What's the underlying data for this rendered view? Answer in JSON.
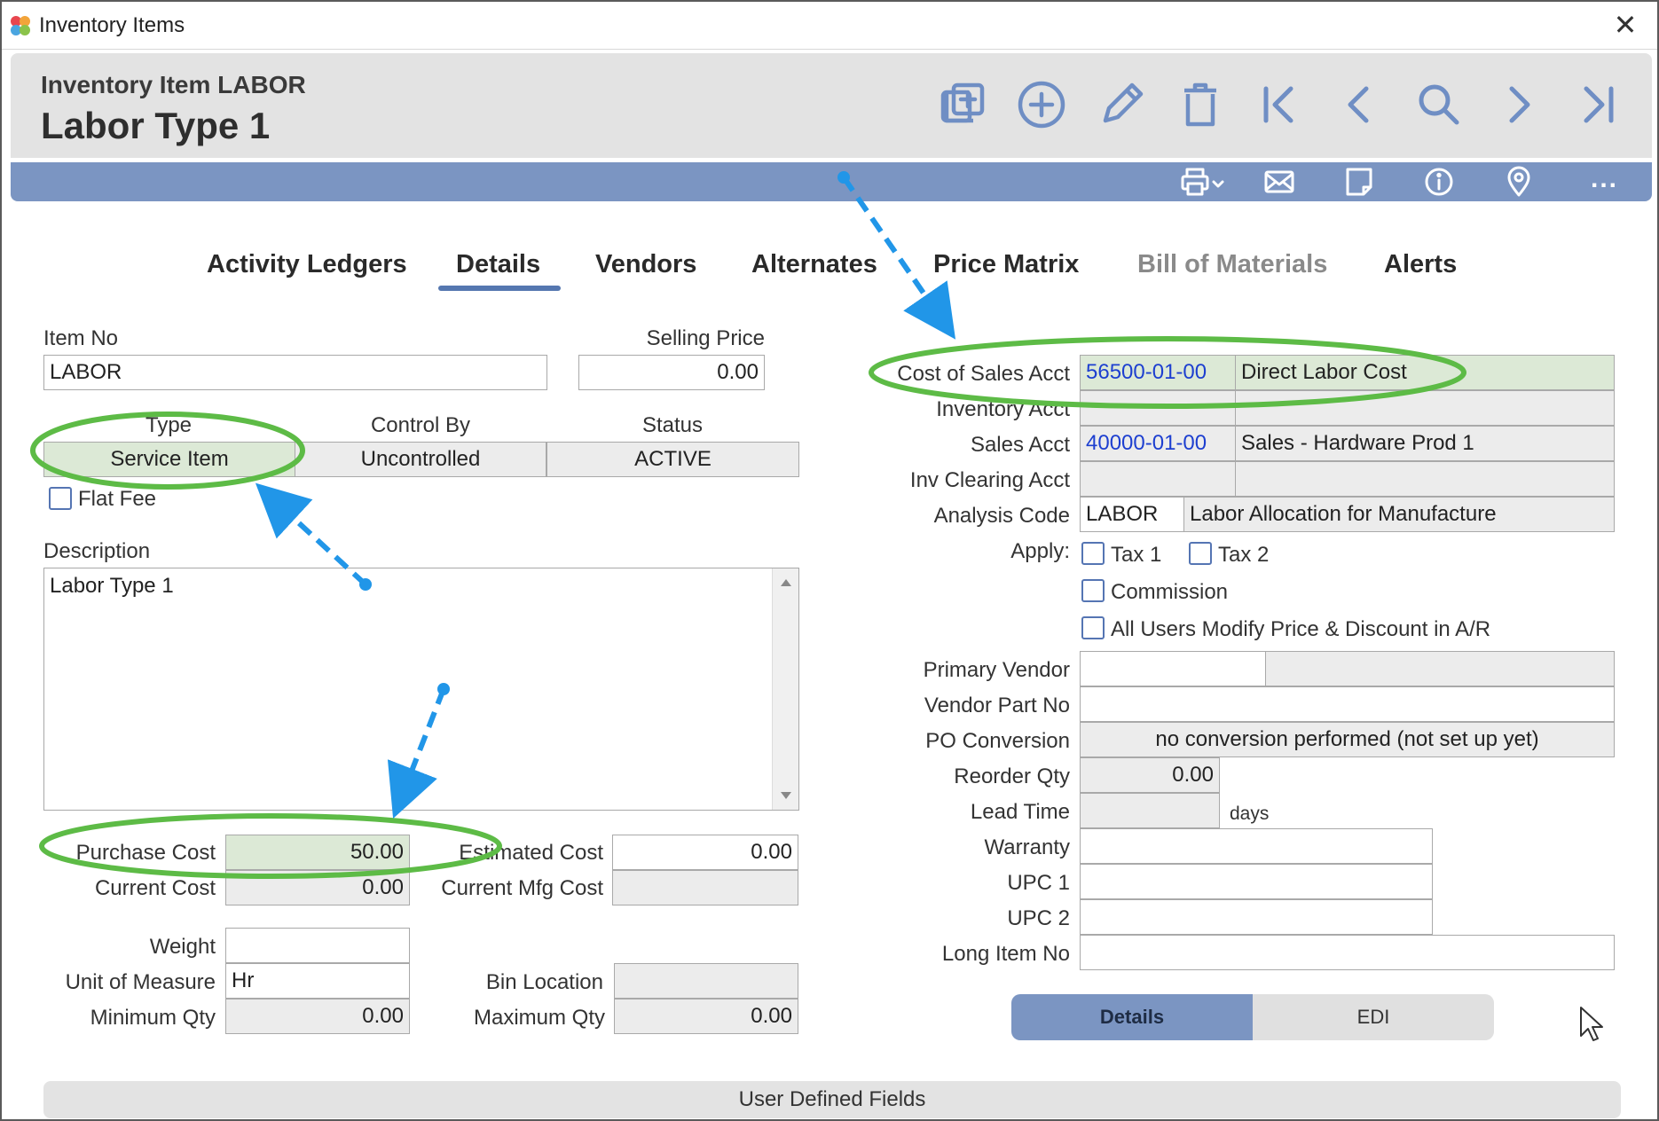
{
  "window": {
    "title": "Inventory Items",
    "close_glyph": "✕"
  },
  "header": {
    "subtitle": "Inventory Item LABOR",
    "title": "Labor Type 1"
  },
  "toolbar": {
    "icons": [
      "copy-add-icon",
      "add-icon",
      "edit-icon",
      "delete-icon",
      "first-record-icon",
      "previous-record-icon",
      "search-icon",
      "next-record-icon",
      "last-record-icon"
    ]
  },
  "actionbar": {
    "icons": [
      "print-icon",
      "email-icon",
      "note-icon",
      "info-icon",
      "location-icon"
    ],
    "more": "..."
  },
  "tabs": [
    "Activity Ledgers",
    "Details",
    "Vendors",
    "Alternates",
    "Price Matrix",
    "Bill of Materials",
    "Alerts"
  ],
  "left": {
    "item_no_label": "Item No",
    "item_no": "LABOR",
    "selling_price_label": "Selling Price",
    "selling_price": "0.00",
    "type_label": "Type",
    "type": "Service Item",
    "control_by_label": "Control By",
    "control_by": "Uncontrolled",
    "status_label": "Status",
    "status": "ACTIVE",
    "flat_fee_label": "Flat Fee",
    "description_label": "Description",
    "description": "Labor Type 1",
    "purchase_cost_label": "Purchase Cost",
    "purchase_cost": "50.00",
    "estimated_cost_label": "Estimated Cost",
    "estimated_cost": "0.00",
    "current_cost_label": "Current Cost",
    "current_cost": "0.00",
    "current_mfg_cost_label": "Current Mfg Cost",
    "current_mfg_cost": "",
    "weight_label": "Weight",
    "weight": "",
    "uom_label": "Unit of Measure",
    "uom": "Hr",
    "bin_location_label": "Bin Location",
    "bin_location": "",
    "min_qty_label": "Minimum Qty",
    "min_qty": "0.00",
    "max_qty_label": "Maximum Qty",
    "max_qty": "0.00"
  },
  "right": {
    "cost_of_sales_label": "Cost of Sales Acct",
    "cost_of_sales_acct": "56500-01-00",
    "cost_of_sales_desc": "Direct Labor Cost",
    "inventory_acct_label": "Inventory Acct",
    "sales_acct_label": "Sales Acct",
    "sales_acct": "40000-01-00",
    "sales_acct_desc": "Sales - Hardware Prod 1",
    "inv_clearing_label": "Inv Clearing Acct",
    "analysis_code_label": "Analysis Code",
    "analysis_code": "LABOR",
    "analysis_desc": "Labor Allocation for Manufacture",
    "apply_label": "Apply:",
    "tax1_label": "Tax 1",
    "tax2_label": "Tax 2",
    "commission_label": "Commission",
    "all_users_label": "All Users Modify Price & Discount in A/R",
    "primary_vendor_label": "Primary Vendor",
    "vendor_part_label": "Vendor Part No",
    "po_conversion_label": "PO Conversion",
    "po_conversion": "no conversion performed (not set up yet)",
    "reorder_qty_label": "Reorder Qty",
    "reorder_qty": "0.00",
    "lead_time_label": "Lead Time",
    "lead_time_unit": "days",
    "warranty_label": "Warranty",
    "upc1_label": "UPC 1",
    "upc2_label": "UPC 2",
    "long_item_label": "Long Item No"
  },
  "bottom": {
    "details_tab": "Details",
    "edi_tab": "EDI",
    "user_defined": "User Defined Fields"
  },
  "colors": {
    "accent": "#7b95c2",
    "highlight_ellipse": "#5dbb46",
    "annotation_arrow": "#2196e8",
    "link": "#1d3fd0"
  }
}
